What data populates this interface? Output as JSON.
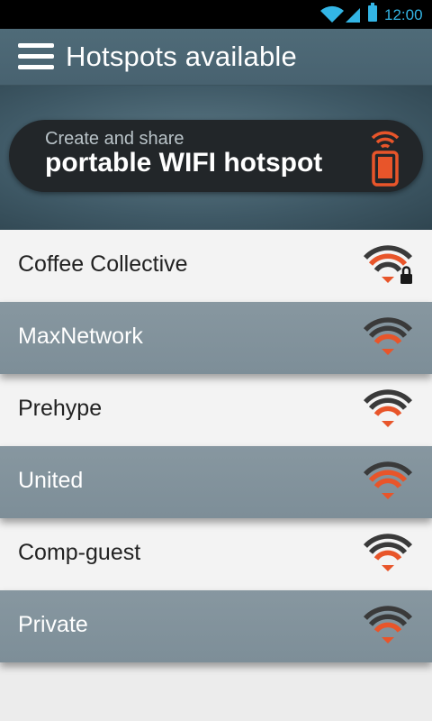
{
  "status_bar": {
    "time": "12:00",
    "icons": [
      "wifi-icon",
      "cell-signal-icon",
      "battery-icon"
    ],
    "accent_color": "#33b5e5"
  },
  "app_bar": {
    "title": "Hotspots available",
    "menu_icon": "hamburger-menu-icon"
  },
  "share_banner": {
    "line1": "Create and share",
    "line2": "portable WIFI hotspot",
    "icon": "phone-broadcast-icon",
    "accent_color": "#e8552a"
  },
  "hotspots": [
    {
      "name": "Coffee Collective",
      "locked": true
    },
    {
      "name": "MaxNetwork",
      "locked": false
    },
    {
      "name": "Prehype",
      "locked": false
    },
    {
      "name": "United",
      "locked": false
    },
    {
      "name": "Comp-guest",
      "locked": false
    },
    {
      "name": "Private",
      "locked": false
    }
  ],
  "colors": {
    "header": "#4f6b78",
    "dark_row": "#8797a0",
    "light_row": "#f3f3f3",
    "signal_orange": "#e8552a",
    "signal_dark": "#3a3a3a"
  }
}
